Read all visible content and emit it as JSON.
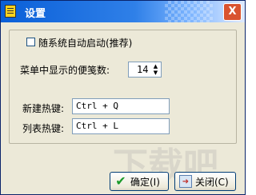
{
  "window": {
    "title": "设置",
    "close_glyph": "X"
  },
  "options": {
    "autostart_label": "随系统自动启动(推荐)",
    "autostart_checked": false,
    "note_count_label": "菜单中显示的便笺数:",
    "note_count_value": "14",
    "new_hotkey_label": "新建热键:",
    "new_hotkey_value": "Ctrl + Q",
    "list_hotkey_label": "列表热键:",
    "list_hotkey_value": "Ctrl + L"
  },
  "buttons": {
    "ok_label": "确定(I)",
    "close_label": "关闭(C)"
  },
  "icons": {
    "app": "notepad-icon",
    "ok": "checkmark-icon",
    "close": "exit-door-icon",
    "spin_up": "spin-up-arrow-icon",
    "spin_down": "spin-down-arrow-icon"
  },
  "watermark": "下载吧"
}
